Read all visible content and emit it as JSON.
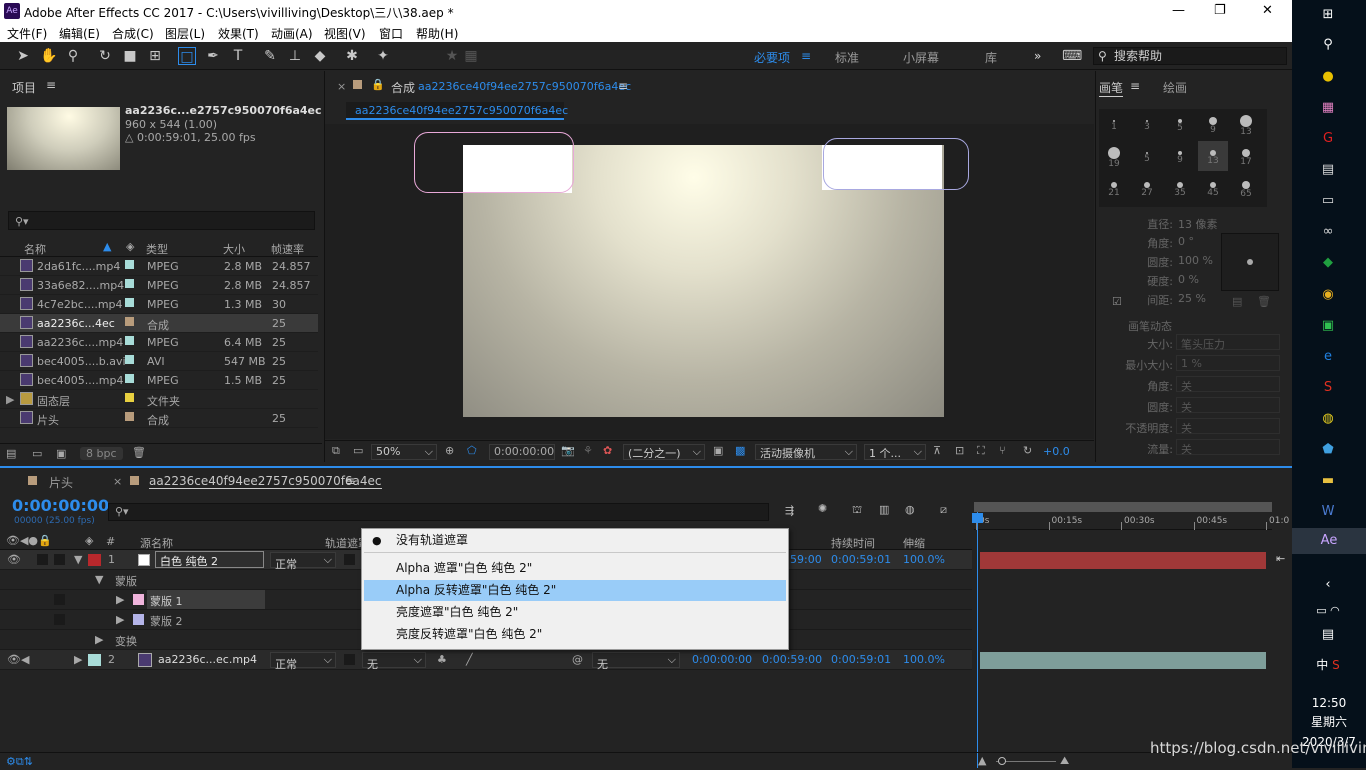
{
  "window": {
    "logo": "Ae",
    "title": "Adobe After Effects CC 2017 - C:\\Users\\vivilliving\\Desktop\\三八\\38.aep *",
    "min": "—",
    "max": "❐",
    "close": "✕"
  },
  "menu": [
    "文件(F)",
    "编辑(E)",
    "合成(C)",
    "图层(L)",
    "效果(T)",
    "动画(A)",
    "视图(V)",
    "窗口",
    "帮助(H)"
  ],
  "workspaces": [
    "必要项",
    "标准",
    "小屏幕",
    "库"
  ],
  "workspace_active": "必要项",
  "more": "»",
  "help_placeholder": "搜索帮助",
  "project": {
    "title": "项目",
    "item_name": "aa2236c...e2757c950070f6a4ec ▼",
    "item_dims": "960 x 544 (1.00)",
    "item_dur": "△ 0:00:59:01, 25.00 fps",
    "search_icon": "⚲▾",
    "cols": [
      "名称",
      "类型",
      "大小",
      "帧速率"
    ],
    "rows": [
      {
        "name": "2da61fc....mp4",
        "type": "MPEG",
        "size": "2.8 MB",
        "fps": "24.857",
        "color": "#a8dcd8"
      },
      {
        "name": "33a6e82....mp4",
        "type": "MPEG",
        "size": "2.8 MB",
        "fps": "24.857",
        "color": "#a8dcd8"
      },
      {
        "name": "4c7e2bc....mp4",
        "type": "MPEG",
        "size": "1.3 MB",
        "fps": "30",
        "color": "#a8dcd8"
      },
      {
        "name": "aa2236c...4ec",
        "type": "合成",
        "size": "",
        "fps": "25",
        "color": "#b89c7c"
      },
      {
        "name": "aa2236c....mp4",
        "type": "MPEG",
        "size": "6.4 MB",
        "fps": "25",
        "color": "#a8dcd8"
      },
      {
        "name": "bec4005....b.avi",
        "type": "AVI",
        "size": "547 MB",
        "fps": "25",
        "color": "#a8dcd8"
      },
      {
        "name": "bec4005....mp4",
        "type": "MPEG",
        "size": "1.5 MB",
        "fps": "25",
        "color": "#a8dcd8"
      },
      {
        "name": "固态层",
        "type": "文件夹",
        "size": "",
        "fps": "",
        "color": "#e8d040"
      },
      {
        "name": "片头",
        "type": "合成",
        "size": "",
        "fps": "25",
        "color": "#b89c7c"
      }
    ],
    "bpc": "8 bpc"
  },
  "comp": {
    "tab_label": "合成",
    "tab_name": "aa2236ce40f94ee2757c950070f6a4ec",
    "sub_tab": "aa2236ce40f94ee2757c950070f6a4ec",
    "zoom": "50%",
    "time": "0:00:00:00",
    "res": "(二分之一)",
    "camera": "活动摄像机",
    "views": "1 个...",
    "exposure": "+0.0"
  },
  "brush": {
    "tab1": "画笔",
    "tab2": "绘画",
    "sizes": [
      [
        "1",
        "3",
        "5",
        "9",
        "13"
      ],
      [
        "19",
        "5",
        "9",
        "13",
        "17"
      ],
      [
        "21",
        "27",
        "35",
        "45",
        "65"
      ]
    ],
    "props": [
      {
        "k": "直径:",
        "v": "13 像素"
      },
      {
        "k": "角度:",
        "v": "0 °"
      },
      {
        "k": "圆度:",
        "v": "100 %"
      },
      {
        "k": "硬度:",
        "v": "0 %"
      },
      {
        "k": "间距:",
        "v": "25 %"
      }
    ],
    "dyn": "画笔动态",
    "dyn_props": [
      {
        "k": "大小:",
        "v": "笔头压力"
      },
      {
        "k": "最小大小:",
        "v": "1 %"
      },
      {
        "k": "角度:",
        "v": "关"
      },
      {
        "k": "圆度:",
        "v": "关"
      },
      {
        "k": "不透明度:",
        "v": "关"
      },
      {
        "k": "流量:",
        "v": "关"
      }
    ]
  },
  "timeline": {
    "tab1": "片头",
    "tab2": "aa2236ce40f94ee2757c950070f6a4ec",
    "time": "0:00:00:00",
    "frames": "00000 (25.00 fps)",
    "cols": {
      "num": "#",
      "src": "源名称",
      "track": "轨道遮罩",
      "dur": "持续时间",
      "stretch": "伸缩"
    },
    "ruler": [
      "0s",
      "00:15s",
      "00:30s",
      "00:45s",
      "01:0"
    ],
    "layer1": {
      "num": "1",
      "name": "白色 纯色 2",
      "mode": "正常",
      "out": "59:00",
      "dur": "0:00:59:01",
      "stretch": "100.0%"
    },
    "mask_group": "蒙版",
    "mask1": "蒙版 1",
    "mask2": "蒙版 2",
    "transform": "变换",
    "layer2": {
      "num": "2",
      "name": "aa2236c...ec.mp4",
      "mode": "正常",
      "track": "无",
      "parent": "无",
      "in": "0:00:00:00",
      "out": "0:00:59:00",
      "dur": "0:00:59:01",
      "stretch": "100.0%"
    }
  },
  "dropdown": {
    "bullet": "●",
    "items": [
      "没有轨道遮罩",
      "Alpha 遮罩\"白色 纯色 2\"",
      "Alpha 反转遮罩\"白色 纯色 2\"",
      "亮度遮罩\"白色 纯色 2\"",
      "亮度反转遮罩\"白色 纯色 2\""
    ],
    "highlight_color": "#99ccf8"
  },
  "taskbar": {
    "ime": "中",
    "clock": "12:50",
    "weekday": "星期六",
    "date": "2020/3/7"
  },
  "watermark": "https://blog.csdn.net/vivilliving"
}
